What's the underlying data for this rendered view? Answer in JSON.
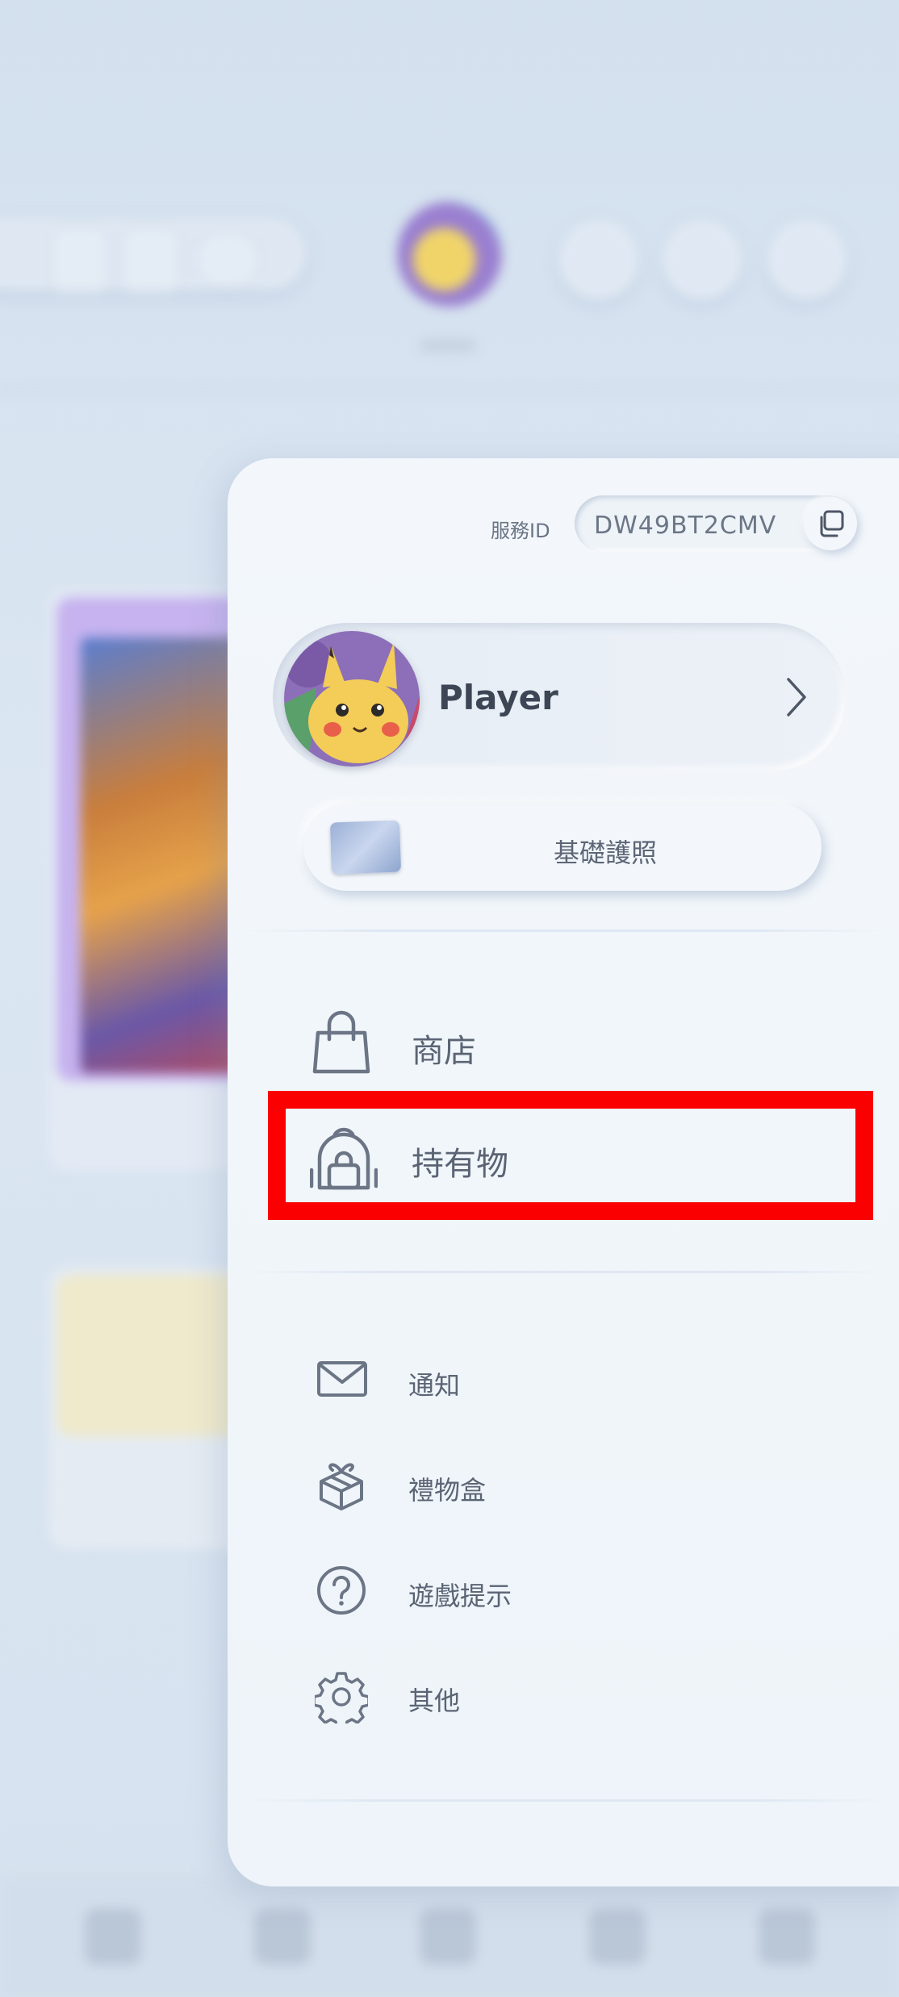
{
  "service_id": {
    "label": "服務ID",
    "value": "DW49BT2CMV"
  },
  "profile": {
    "name": "Player"
  },
  "passport": {
    "label": "基礎護照"
  },
  "primary_menu": [
    {
      "label": "商店",
      "icon": "shopping-bag-icon"
    },
    {
      "label": "持有物",
      "icon": "backpack-icon"
    }
  ],
  "secondary_menu": [
    {
      "label": "通知",
      "icon": "envelope-icon"
    },
    {
      "label": "禮物盒",
      "icon": "gift-box-icon"
    },
    {
      "label": "遊戲提示",
      "icon": "question-circle-icon"
    },
    {
      "label": "其他",
      "icon": "gear-icon"
    }
  ],
  "colors": {
    "highlight": "#fb0000",
    "drawer_bg": "#f3f7fb",
    "icon": "#6b7585"
  }
}
